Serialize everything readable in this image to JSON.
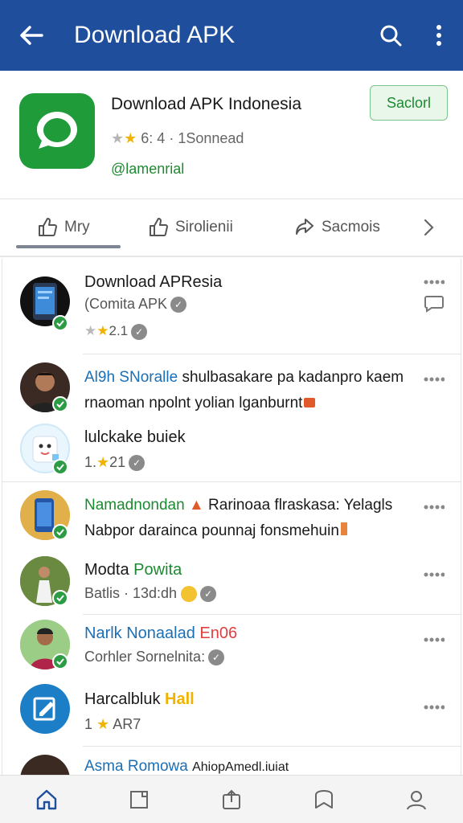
{
  "appbar": {
    "title": "Download APK"
  },
  "app": {
    "name": "Download APK Indonesia",
    "rating_text": "6: 4 · 1Sonnead",
    "tag": "@lamenrial",
    "install_label": "Saclorl"
  },
  "tabs": [
    {
      "label": "Mry"
    },
    {
      "label": "Sirolienii"
    },
    {
      "label": "Sacmois"
    }
  ],
  "feed": [
    {
      "title": "Download APResia",
      "subtitle": "(Comita APK",
      "meta": "2:1",
      "rating": "2.1"
    },
    {
      "name": "Al9h SNoralle",
      "text1": "shulbasakare pa kadanpro kaem",
      "text2": "rnaoman npolnt yolian lganburnt"
    },
    {
      "name": "lulckake buiek",
      "meta": "1.",
      "meta2": "21"
    },
    {
      "name": "Namadnondan",
      "text1a": "Rarinoaa flraskasa: Yelagls",
      "text2": "Nabpor darainca pounnaj fonsmehuin"
    },
    {
      "name": "Modta",
      "name2": "Powita",
      "meta": "Batlis · 13d:dh"
    },
    {
      "name": "Narlk Nonaalad",
      "name2": "En06",
      "meta": "Corhler Sornelnita:"
    },
    {
      "name": "Harcalbluk",
      "name2": "Hall",
      "meta": "1",
      "meta2": "AR7"
    },
    {
      "name": "Asma Romowa",
      "text1": "AhiopAmedl.iuiat"
    }
  ],
  "colors": {
    "appbar": "#1f4e9c",
    "accent_green": "#1c8a30",
    "link_blue": "#1b6fb5",
    "star": "#f0b400"
  }
}
